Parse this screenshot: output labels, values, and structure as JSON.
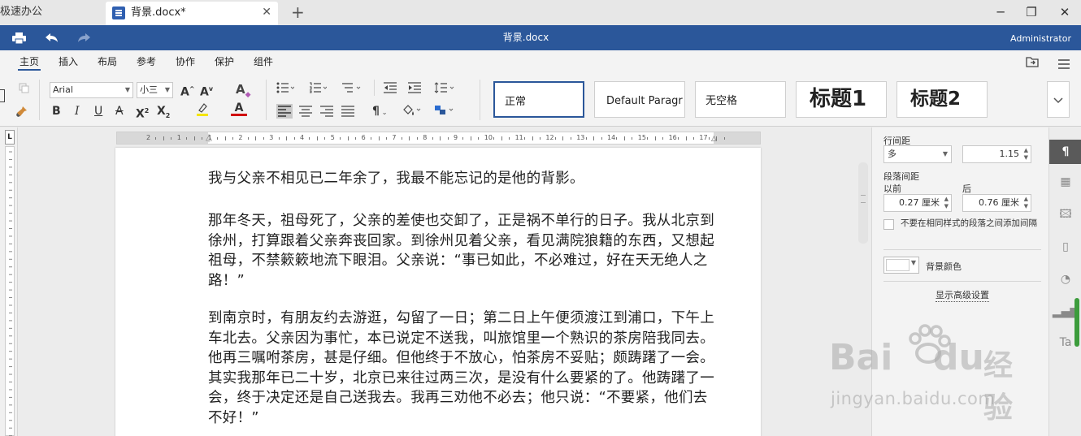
{
  "tabs": {
    "inactive_label": "极速办公",
    "active_label": "背景.docx*",
    "close": "✕",
    "new": "+"
  },
  "window": {
    "minimize": "─",
    "restore": "❐",
    "close": "✕"
  },
  "titlebar": {
    "title": "背景.docx",
    "user": "Administrator"
  },
  "menu": [
    "主页",
    "插入",
    "布局",
    "参考",
    "协作",
    "保护",
    "组件"
  ],
  "ribbon": {
    "font_name": "Arial",
    "font_size": "小三",
    "styles": [
      "正常",
      "Default Paragr",
      "无空格",
      "标题1",
      "标题2"
    ]
  },
  "document": {
    "paragraphs": [
      "我与父亲不相见已二年余了，我最不能忘记的是他的背影。",
      "那年冬天，祖母死了，父亲的差使也交卸了，正是祸不单行的日子。我从北京到徐州，打算跟着父亲奔丧回家。到徐州见着父亲，看见满院狼籍的东西，又想起祖母，不禁簌簌地流下眼泪。父亲说：“事已如此，不必难过，好在天无绝人之路！”",
      "到南京时，有朋友约去游逛，勾留了一日；第二日上午便须渡江到浦口，下午上车北去。父亲因为事忙，本已说定不送我，叫旅馆里一个熟识的茶房陪我同去。他再三嘱咐茶房，甚是仔细。但他终于不放心，怕茶房不妥贴；颇踌躇了一会。其实我那年已二十岁，北京已来往过两三次，是没有什么要紧的了。他踌躇了一会，终于决定还是自己送我去。我再三劝他不必去；他只说：“不要紧，他们去不好！”"
    ]
  },
  "ruler": {
    "marks": [
      "2",
      "1",
      "1",
      "2",
      "3",
      "4",
      "5",
      "6",
      "7",
      "8",
      "9",
      "10",
      "11",
      "12",
      "13",
      "14",
      "15",
      "16",
      "17"
    ],
    "corner": "L"
  },
  "panel": {
    "line_spacing_label": "行间距",
    "line_spacing_mode": "多",
    "line_spacing_value": "1.15",
    "para_spacing_label": "段落间距",
    "before_label": "以前",
    "after_label": "后",
    "before_value": "0.27 厘米",
    "after_value": "0.76 厘米",
    "no_space_checkbox": "不要在相同样式的段落之间添加间隔",
    "bg_color_label": "背景颜色",
    "advanced_link": "显示高级设置"
  },
  "watermark": {
    "brand": "Bai",
    "brand2": "du",
    "brand_cn": "经验",
    "url": "jingyan.baidu.com"
  },
  "colors": {
    "title_bar": "#2b579a",
    "highlight": "#f5e500",
    "font_color": "#d00000"
  }
}
